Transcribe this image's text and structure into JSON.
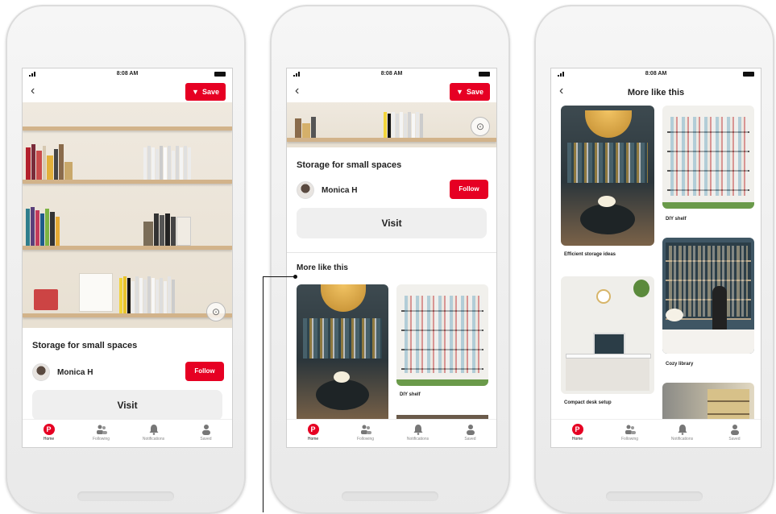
{
  "status_bar": {
    "time": "8:08 AM"
  },
  "save_label": "Save",
  "pin": {
    "title": "Storage for small spaces",
    "author": "Monica H",
    "follow_label": "Follow",
    "visit_label": "Visit"
  },
  "more_like_this": {
    "heading": "More like this",
    "tiles": [
      {
        "label": ""
      },
      {
        "label": "DIY shelf"
      },
      {
        "label": "Efficient storage ideas"
      },
      {
        "label": "Compact desk setup"
      },
      {
        "label": "Cozy library"
      }
    ]
  },
  "tabbar": {
    "items": [
      {
        "label": "Home",
        "icon": "pinterest-logo-icon"
      },
      {
        "label": "Following",
        "icon": "people-icon"
      },
      {
        "label": "Notifications",
        "icon": "bell-icon"
      },
      {
        "label": "Saved",
        "icon": "person-icon"
      }
    ]
  },
  "colors": {
    "brand": "#e60023",
    "button_gray": "#efefef"
  }
}
